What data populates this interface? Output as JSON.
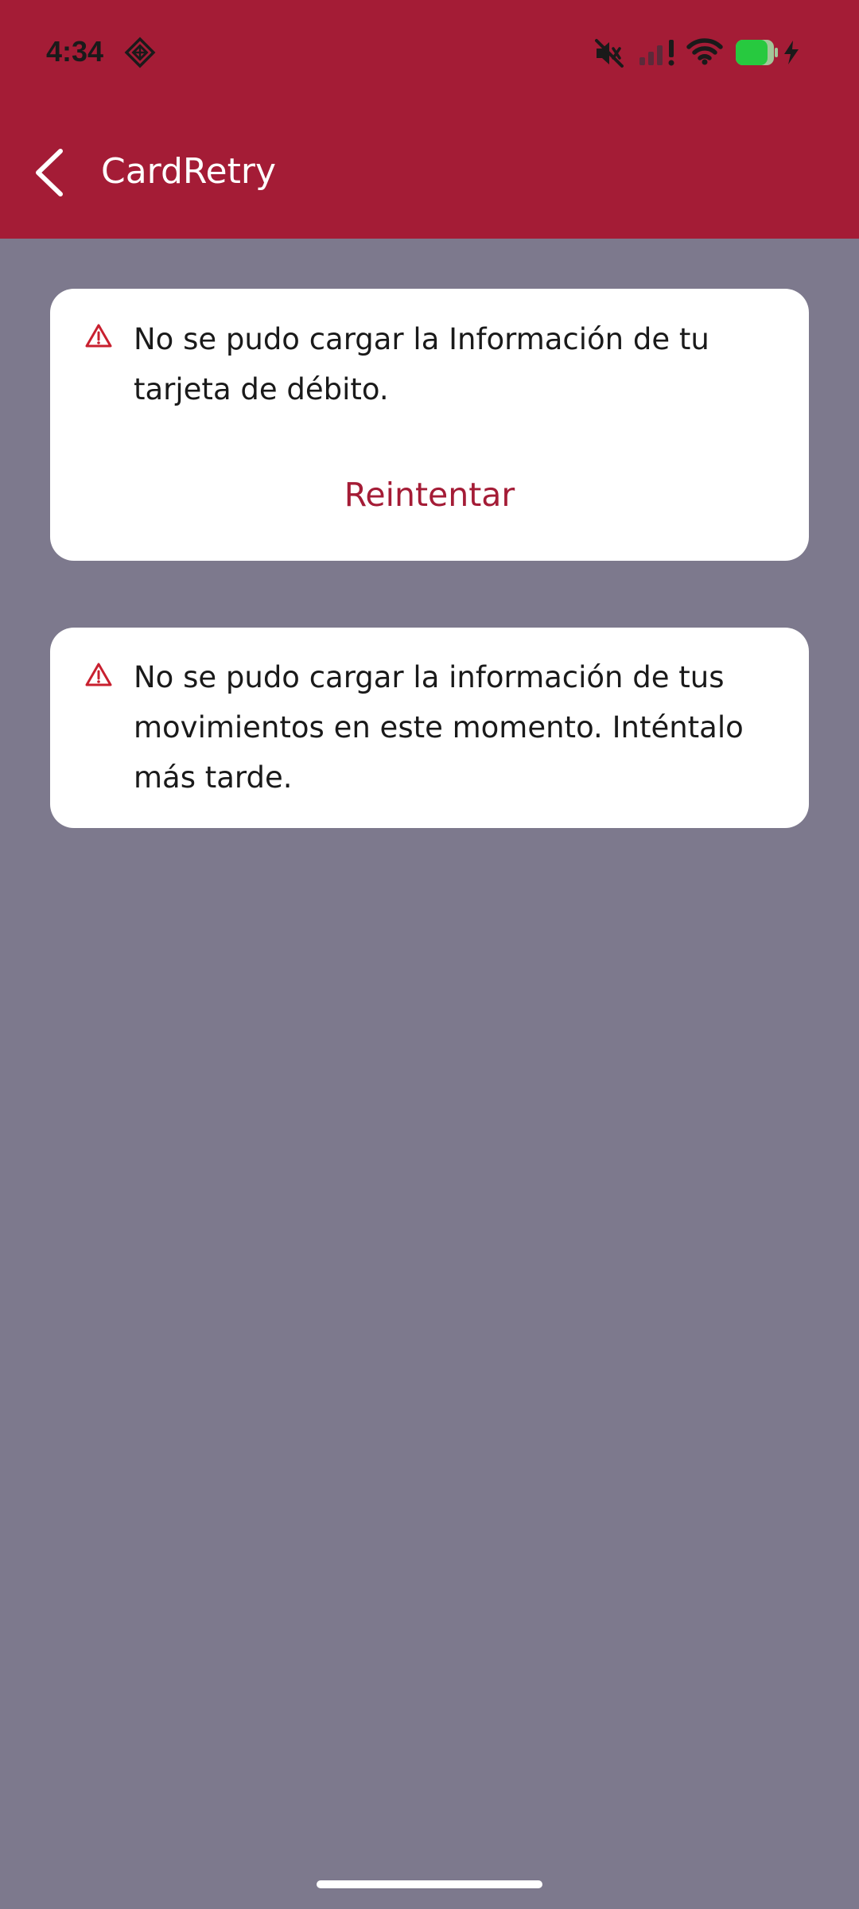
{
  "status_bar": {
    "time": "4:34",
    "icons": [
      "diamond-app-icon",
      "mute-icon",
      "cell-signal-icon",
      "wifi-icon",
      "battery-icon",
      "charging-bolt-icon"
    ]
  },
  "header": {
    "back_icon": "chevron-left-icon",
    "title": "CardRetry"
  },
  "cards": [
    {
      "icon": "warning-icon",
      "lines": [
        "No se pudo cargar la Información de tu",
        "tarjeta de débito."
      ],
      "action_label": "Reintentar"
    },
    {
      "icon": "warning-icon",
      "lines": [
        "No se pudo cargar la información de tus",
        "movimientos en este momento. Inténtalo",
        "más tarde."
      ]
    }
  ],
  "colors": {
    "brand": "#a41c36",
    "background": "#7d798d",
    "card": "#ffffff",
    "warning": "#c8202f"
  }
}
